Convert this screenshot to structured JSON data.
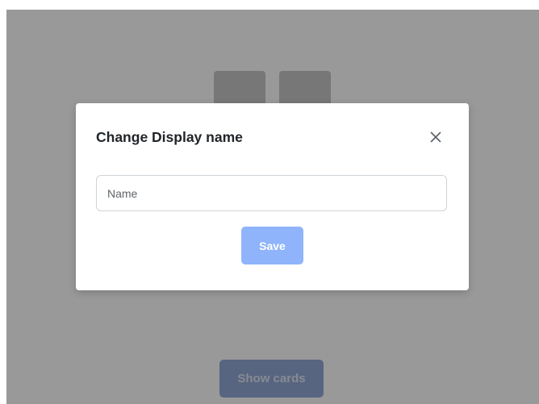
{
  "background": {
    "show_cards_label": "Show cards"
  },
  "modal": {
    "title": "Change Display name",
    "close_icon": "close-icon",
    "name_input": {
      "placeholder": "Name",
      "value": ""
    },
    "save_label": "Save"
  },
  "colors": {
    "overlay": "#000000",
    "save_button": "#8fb4fb",
    "show_cards_button": "#93a9d6"
  }
}
